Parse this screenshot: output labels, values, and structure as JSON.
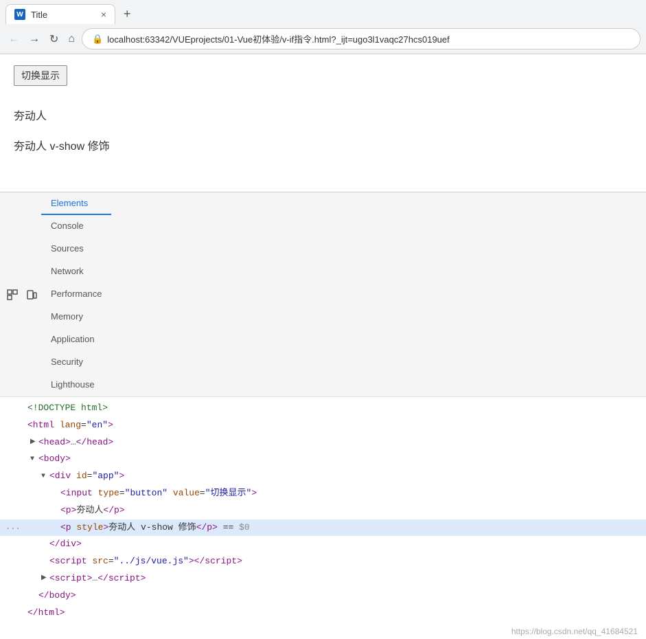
{
  "browser": {
    "tab": {
      "favicon_label": "W",
      "title": "Title",
      "close_icon": "×",
      "new_tab_icon": "+"
    },
    "nav": {
      "back_icon": "←",
      "forward_icon": "→",
      "refresh_icon": "↻",
      "home_icon": "⌂",
      "lock_icon": "🔒",
      "url": "localhost:63342/VUEprojects/01-Vue初体验/v-if指令.html?_ijt=ugo3l1vaqc27hcs019uef"
    }
  },
  "page": {
    "toggle_button_label": "切换显示",
    "text1": "夯动人",
    "text2": "夯动人 v-show 修饰"
  },
  "devtools": {
    "tabs": [
      {
        "id": "elements",
        "label": "Elements",
        "active": true
      },
      {
        "id": "console",
        "label": "Console",
        "active": false
      },
      {
        "id": "sources",
        "label": "Sources",
        "active": false
      },
      {
        "id": "network",
        "label": "Network",
        "active": false
      },
      {
        "id": "performance",
        "label": "Performance",
        "active": false
      },
      {
        "id": "memory",
        "label": "Memory",
        "active": false
      },
      {
        "id": "application",
        "label": "Application",
        "active": false
      },
      {
        "id": "security",
        "label": "Security",
        "active": false
      },
      {
        "id": "lighthouse",
        "label": "Lighthouse",
        "active": false
      }
    ],
    "dom": {
      "lines": [
        {
          "id": 1,
          "indent": 0,
          "has_triangle": false,
          "triangle_type": "",
          "dots": false,
          "content_html": "<span class='comment'>&lt;!DOCTYPE html&gt;</span>",
          "highlighted": false
        },
        {
          "id": 2,
          "indent": 0,
          "has_triangle": false,
          "triangle_type": "",
          "dots": false,
          "content_html": "<span class='tag'>&lt;html</span> <span class='attr-name'>lang</span>=<span class='attr-value'>\"en\"</span><span class='tag'>&gt;</span>",
          "highlighted": false
        },
        {
          "id": 3,
          "indent": 1,
          "has_triangle": true,
          "triangle_type": "right",
          "dots": false,
          "content_html": "<span class='tag'>&lt;head&gt;</span><span style='color:#555'>…</span><span class='tag'>&lt;/head&gt;</span>",
          "highlighted": false
        },
        {
          "id": 4,
          "indent": 1,
          "has_triangle": true,
          "triangle_type": "down",
          "dots": false,
          "content_html": "<span class='tag'>&lt;body&gt;</span>",
          "highlighted": false
        },
        {
          "id": 5,
          "indent": 2,
          "has_triangle": true,
          "triangle_type": "down",
          "dots": false,
          "content_html": "<span class='tag'>&lt;div</span> <span class='attr-name'>id</span>=<span class='attr-value'>\"app\"</span><span class='tag'>&gt;</span>",
          "highlighted": false
        },
        {
          "id": 6,
          "indent": 3,
          "has_triangle": false,
          "triangle_type": "",
          "dots": false,
          "content_html": "<span class='tag'>&lt;input</span> <span class='attr-name'>type</span>=<span class='attr-value'>\"button\"</span> <span class='attr-name'>value</span>=<span class='attr-value'>\"切换显示\"</span><span class='tag'>&gt;</span>",
          "highlighted": false
        },
        {
          "id": 7,
          "indent": 3,
          "has_triangle": false,
          "triangle_type": "",
          "dots": false,
          "content_html": "<span class='tag'>&lt;p&gt;</span>夯动人<span class='tag'>&lt;/p&gt;</span>",
          "highlighted": false
        },
        {
          "id": 8,
          "indent": 3,
          "has_triangle": false,
          "triangle_type": "",
          "dots": true,
          "content_html": "<span class='tag'>&lt;p</span> <span class='attr-name'>style</span><span class='tag'>&gt;</span>夯动人 v-show 修饰<span class='tag'>&lt;/p&gt;</span> == <span style='color:#888'>$0</span>",
          "highlighted": true
        },
        {
          "id": 9,
          "indent": 2,
          "has_triangle": false,
          "triangle_type": "",
          "dots": false,
          "content_html": "<span class='tag'>&lt;/div&gt;</span>",
          "highlighted": false
        },
        {
          "id": 10,
          "indent": 2,
          "has_triangle": false,
          "triangle_type": "",
          "dots": false,
          "content_html": "<span class='tag'>&lt;script</span> <span class='attr-name'>src</span>=<span class='attr-value'>\"../js/vue.js\"</span><span class='tag'>&gt;&lt;/script&gt;</span>",
          "highlighted": false
        },
        {
          "id": 11,
          "indent": 2,
          "has_triangle": true,
          "triangle_type": "right",
          "dots": false,
          "content_html": "<span class='tag'>&lt;script&gt;</span><span style='color:#555'>…</span><span class='tag'>&lt;/script&gt;</span>",
          "highlighted": false
        },
        {
          "id": 12,
          "indent": 1,
          "has_triangle": false,
          "triangle_type": "",
          "dots": false,
          "content_html": "<span class='tag'>&lt;/body&gt;</span>",
          "highlighted": false
        },
        {
          "id": 13,
          "indent": 0,
          "has_triangle": false,
          "triangle_type": "",
          "dots": false,
          "content_html": "<span class='tag'>&lt;/html&gt;</span>",
          "highlighted": false
        }
      ]
    }
  },
  "watermark": {
    "text": "https://blog.csdn.net/qq_41684521"
  }
}
